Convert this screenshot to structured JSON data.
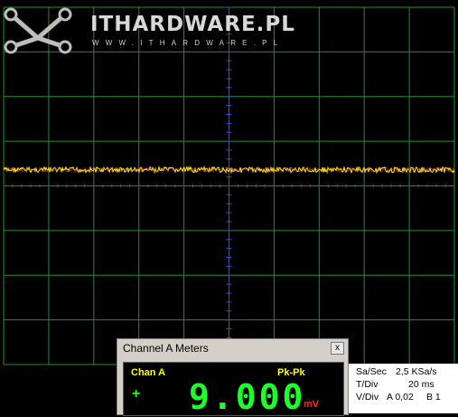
{
  "watermark": {
    "brand": "ITHARDWARE.PL",
    "url": "WWW.ITHARDWARE.PL",
    "logo_icon": "x-network-logo-icon"
  },
  "scope": {
    "grid_color": "#1f8f2c",
    "center_axis_color": "#2a4fff",
    "trace_color": "#ffff00",
    "trace_level_fraction": 0.455
  },
  "meters_window": {
    "title": "Channel A Meters",
    "close_label": "x",
    "channel": "Chan A",
    "measurement": "Pk-Pk",
    "sign": "+",
    "reading": "9.000",
    "unit": "mV"
  },
  "settings": {
    "sa_sec_label": "Sa/Sec",
    "sa_sec_value": "2,5 KSa/s",
    "t_div_label": "T/Div",
    "t_div_value": "20 ms",
    "v_div_label": "V/Div",
    "v_div_a": "A 0,02",
    "v_div_b": "B 1"
  }
}
